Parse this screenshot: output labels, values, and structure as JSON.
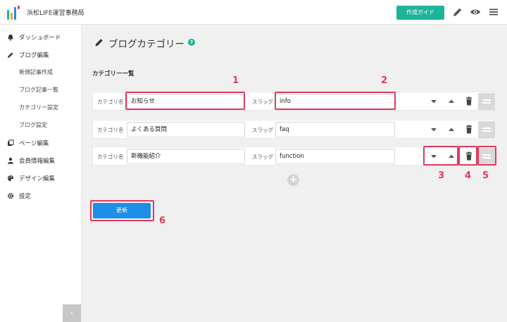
{
  "header": {
    "site_name": "浜松LIFE運営事務局",
    "guide_label": "作成ガイド",
    "icons": [
      "pencil-icon",
      "eye-icon",
      "menu-icon"
    ],
    "logo_colors": [
      "#1fb39a",
      "#f5a623",
      "#1e8fe6",
      "#e3395d"
    ]
  },
  "sidebar": {
    "items": [
      {
        "label": "ダッシュボード",
        "icon": "dashboard-icon"
      },
      {
        "label": "ブログ編集",
        "icon": "pencil-icon"
      },
      {
        "label": "新規記事作成"
      },
      {
        "label": "ブログ記事一覧"
      },
      {
        "label": "カテゴリー設定"
      },
      {
        "label": "ブログ設定"
      },
      {
        "label": "ページ編集",
        "icon": "pages-icon"
      },
      {
        "label": "会員情報編集",
        "icon": "user-icon"
      },
      {
        "label": "デザイン編集",
        "icon": "palette-icon"
      },
      {
        "label": "設定",
        "icon": "gear-icon"
      }
    ],
    "collapse_label": "‹"
  },
  "main": {
    "title": "ブログカテゴリー",
    "help": "?",
    "section_title": "カテゴリー一覧",
    "name_label": "カテゴリ名",
    "slug_label": "スラッグ",
    "categories": [
      {
        "name": "お知らせ",
        "slug": "info"
      },
      {
        "name": "よくある質問",
        "slug": "faq"
      },
      {
        "name": "新機能紹介",
        "slug": "function"
      }
    ],
    "add_label": "+",
    "update_label": "更新"
  },
  "annotations": {
    "color": "#e3395d",
    "numbers": [
      "1",
      "2",
      "3",
      "4",
      "5",
      "6"
    ]
  }
}
